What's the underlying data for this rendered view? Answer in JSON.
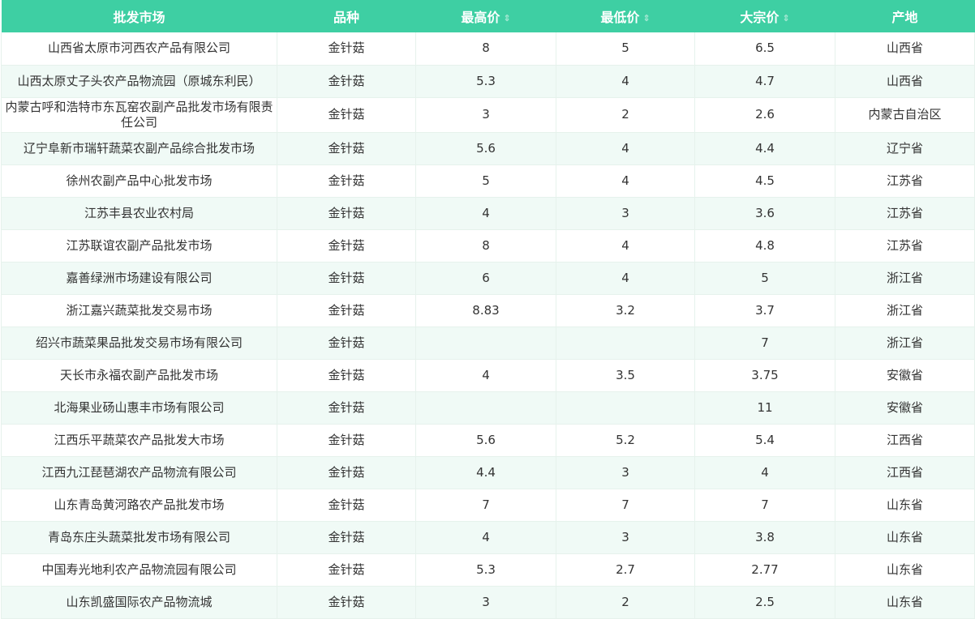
{
  "table": {
    "headers": {
      "market": "批发市场",
      "variety": "品种",
      "high": "最高价",
      "low": "最低价",
      "bulk": "大宗价",
      "origin": "产地"
    },
    "sort_icon": "sort-caret-icon",
    "header_color": "#3ecfa3",
    "stripe_color": "#f0faf6",
    "rows": [
      {
        "market": "山西省太原市河西农产品有限公司",
        "variety": "金针菇",
        "high": "8",
        "low": "5",
        "bulk": "6.5",
        "origin": "山西省"
      },
      {
        "market": "山西太原丈子头农产品物流园（原城东利民）",
        "variety": "金针菇",
        "high": "5.3",
        "low": "4",
        "bulk": "4.7",
        "origin": "山西省"
      },
      {
        "market": "内蒙古呼和浩特市东瓦窑农副产品批发市场有限责任公司",
        "variety": "金针菇",
        "high": "3",
        "low": "2",
        "bulk": "2.6",
        "origin": "内蒙古自治区"
      },
      {
        "market": "辽宁阜新市瑞轩蔬菜农副产品综合批发市场",
        "variety": "金针菇",
        "high": "5.6",
        "low": "4",
        "bulk": "4.4",
        "origin": "辽宁省"
      },
      {
        "market": "徐州农副产品中心批发市场",
        "variety": "金针菇",
        "high": "5",
        "low": "4",
        "bulk": "4.5",
        "origin": "江苏省"
      },
      {
        "market": "江苏丰县农业农村局",
        "variety": "金针菇",
        "high": "4",
        "low": "3",
        "bulk": "3.6",
        "origin": "江苏省"
      },
      {
        "market": "江苏联谊农副产品批发市场",
        "variety": "金针菇",
        "high": "8",
        "low": "4",
        "bulk": "4.8",
        "origin": "江苏省"
      },
      {
        "market": "嘉善绿洲市场建设有限公司",
        "variety": "金针菇",
        "high": "6",
        "low": "4",
        "bulk": "5",
        "origin": "浙江省"
      },
      {
        "market": "浙江嘉兴蔬菜批发交易市场",
        "variety": "金针菇",
        "high": "8.83",
        "low": "3.2",
        "bulk": "3.7",
        "origin": "浙江省"
      },
      {
        "market": "绍兴市蔬菜果品批发交易市场有限公司",
        "variety": "金针菇",
        "high": "",
        "low": "",
        "bulk": "7",
        "origin": "浙江省"
      },
      {
        "market": "天长市永福农副产品批发市场",
        "variety": "金针菇",
        "high": "4",
        "low": "3.5",
        "bulk": "3.75",
        "origin": "安徽省"
      },
      {
        "market": "北海果业砀山惠丰市场有限公司",
        "variety": "金针菇",
        "high": "",
        "low": "",
        "bulk": "11",
        "origin": "安徽省"
      },
      {
        "market": "江西乐平蔬菜农产品批发大市场",
        "variety": "金针菇",
        "high": "5.6",
        "low": "5.2",
        "bulk": "5.4",
        "origin": "江西省"
      },
      {
        "market": "江西九江琵琶湖农产品物流有限公司",
        "variety": "金针菇",
        "high": "4.4",
        "low": "3",
        "bulk": "4",
        "origin": "江西省"
      },
      {
        "market": "山东青岛黄河路农产品批发市场",
        "variety": "金针菇",
        "high": "7",
        "low": "7",
        "bulk": "7",
        "origin": "山东省"
      },
      {
        "market": "青岛东庄头蔬菜批发市场有限公司",
        "variety": "金针菇",
        "high": "4",
        "low": "3",
        "bulk": "3.8",
        "origin": "山东省"
      },
      {
        "market": "中国寿光地利农产品物流园有限公司",
        "variety": "金针菇",
        "high": "5.3",
        "low": "2.7",
        "bulk": "2.77",
        "origin": "山东省"
      },
      {
        "market": "山东凯盛国际农产品物流城",
        "variety": "金针菇",
        "high": "3",
        "low": "2",
        "bulk": "2.5",
        "origin": "山东省"
      }
    ]
  }
}
